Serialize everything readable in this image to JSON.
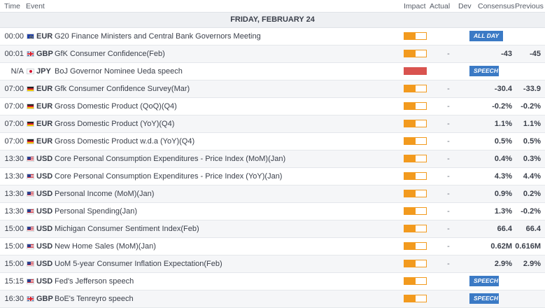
{
  "columns": {
    "time": "Time",
    "event": "Event",
    "impact": "Impact",
    "actual": "Actual",
    "dev": "Dev",
    "consensus": "Consensus",
    "previous": "Previous"
  },
  "day_header": "FRIDAY, FEBRUARY 24",
  "colors": {
    "impact_medium": "#f29a1e",
    "impact_high": "#d9534f",
    "badge": "#3b7ac5"
  },
  "rows": [
    {
      "time": "00:00",
      "flag": "eu-flag-icon",
      "currency": "EUR",
      "event": "G20 Finance Ministers and Central Bank Governors Meeting",
      "impact_level": 0.5,
      "dev": "",
      "consensus": "",
      "previous": "",
      "badge": "ALL DAY"
    },
    {
      "time": "00:01",
      "flag": "gb-flag-icon",
      "currency": "GBP",
      "event": "GfK Consumer Confidence(Feb)",
      "impact_level": 0.5,
      "dev": "-",
      "consensus": "-43",
      "previous": "-45",
      "badge": ""
    },
    {
      "time": "N/A",
      "flag": "jp-flag-icon",
      "currency": "JPY",
      "event": "BoJ Governor Nominee Ueda speech",
      "impact_level": 1,
      "dev": "",
      "consensus": "",
      "previous": "",
      "badge": "SPEECH"
    },
    {
      "time": "07:00",
      "flag": "de-flag-icon",
      "currency": "EUR",
      "event": "Gfk Consumer Confidence Survey(Mar)",
      "impact_level": 0.5,
      "dev": "-",
      "consensus": "-30.4",
      "previous": "-33.9",
      "badge": ""
    },
    {
      "time": "07:00",
      "flag": "de-flag-icon",
      "currency": "EUR",
      "event": "Gross Domestic Product (QoQ)(Q4)",
      "impact_level": 0.5,
      "dev": "-",
      "consensus": "-0.2%",
      "previous": "-0.2%",
      "badge": ""
    },
    {
      "time": "07:00",
      "flag": "de-flag-icon",
      "currency": "EUR",
      "event": "Gross Domestic Product (YoY)(Q4)",
      "impact_level": 0.5,
      "dev": "-",
      "consensus": "1.1%",
      "previous": "1.1%",
      "badge": ""
    },
    {
      "time": "07:00",
      "flag": "de-flag-icon",
      "currency": "EUR",
      "event": "Gross Domestic Product w.d.a (YoY)(Q4)",
      "impact_level": 0.5,
      "dev": "-",
      "consensus": "0.5%",
      "previous": "0.5%",
      "badge": ""
    },
    {
      "time": "13:30",
      "flag": "us-flag-icon",
      "currency": "USD",
      "event": "Core Personal Consumption Expenditures - Price Index (MoM)(Jan)",
      "impact_level": 0.5,
      "dev": "-",
      "consensus": "0.4%",
      "previous": "0.3%",
      "badge": ""
    },
    {
      "time": "13:30",
      "flag": "us-flag-icon",
      "currency": "USD",
      "event": "Core Personal Consumption Expenditures - Price Index (YoY)(Jan)",
      "impact_level": 0.5,
      "dev": "-",
      "consensus": "4.3%",
      "previous": "4.4%",
      "badge": ""
    },
    {
      "time": "13:30",
      "flag": "us-flag-icon",
      "currency": "USD",
      "event": "Personal Income (MoM)(Jan)",
      "impact_level": 0.5,
      "dev": "-",
      "consensus": "0.9%",
      "previous": "0.2%",
      "badge": ""
    },
    {
      "time": "13:30",
      "flag": "us-flag-icon",
      "currency": "USD",
      "event": "Personal Spending(Jan)",
      "impact_level": 0.5,
      "dev": "-",
      "consensus": "1.3%",
      "previous": "-0.2%",
      "badge": ""
    },
    {
      "time": "15:00",
      "flag": "us-flag-icon",
      "currency": "USD",
      "event": "Michigan Consumer Sentiment Index(Feb)",
      "impact_level": 0.5,
      "dev": "-",
      "consensus": "66.4",
      "previous": "66.4",
      "badge": ""
    },
    {
      "time": "15:00",
      "flag": "us-flag-icon",
      "currency": "USD",
      "event": "New Home Sales (MoM)(Jan)",
      "impact_level": 0.5,
      "dev": "-",
      "consensus": "0.62M",
      "previous": "0.616M",
      "badge": ""
    },
    {
      "time": "15:00",
      "flag": "us-flag-icon",
      "currency": "USD",
      "event": "UoM 5-year Consumer Inflation Expectation(Feb)",
      "impact_level": 0.5,
      "dev": "-",
      "consensus": "2.9%",
      "previous": "2.9%",
      "badge": ""
    },
    {
      "time": "15:15",
      "flag": "us-flag-icon",
      "currency": "USD",
      "event": "Fed's Jefferson speech",
      "impact_level": 0.5,
      "dev": "",
      "consensus": "",
      "previous": "",
      "badge": "SPEECH"
    },
    {
      "time": "16:30",
      "flag": "gb-flag-icon",
      "currency": "GBP",
      "event": "BoE's Tenreyro speech",
      "impact_level": 0.5,
      "dev": "",
      "consensus": "",
      "previous": "",
      "badge": "SPEECH"
    }
  ]
}
